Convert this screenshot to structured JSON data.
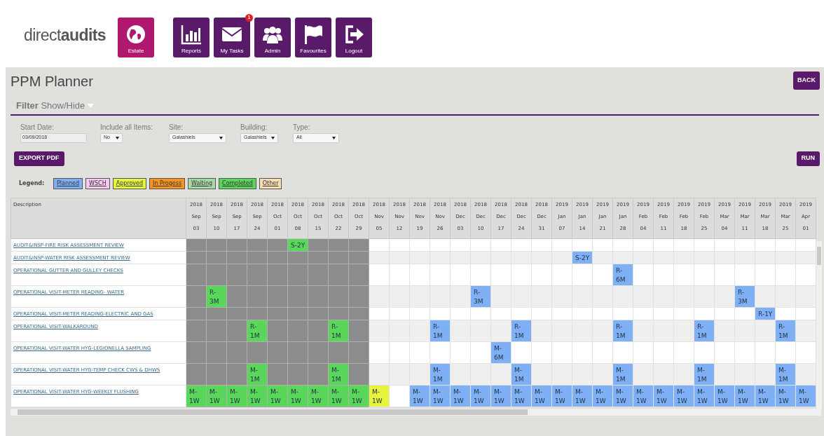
{
  "logo": "direct**audits**",
  "nav": [
    {
      "label": "Estate",
      "selected": true
    },
    {
      "label": "Reports",
      "selected": false
    },
    {
      "label": "My Tasks",
      "selected": false,
      "badge": "1"
    },
    {
      "label": "Admin",
      "selected": false
    },
    {
      "label": "Favourites",
      "selected": false
    },
    {
      "label": "Logout",
      "selected": false
    }
  ],
  "page_title": "PPM Planner",
  "back_button": "BACK",
  "filter_toggle": "**Filter** Show/Hide",
  "filters": [
    {
      "label": "Start Date:",
      "kind": "date",
      "value": "03/09/2018"
    },
    {
      "label": "Include all Items:",
      "kind": "select",
      "value": "No"
    },
    {
      "label": "Site:",
      "kind": "select",
      "value": "Galashiels"
    },
    {
      "label": "Building:",
      "kind": "select",
      "value": "Galashiels"
    },
    {
      "label": "Type:",
      "kind": "select",
      "value": "All"
    }
  ],
  "export_button": "EXPORT PDF",
  "run_button": "RUN",
  "legend_label": "Legend:",
  "legend": [
    {
      "label": "Planned",
      "color": "#7fb0f5"
    },
    {
      "label": "WSCH",
      "color": "#f7c8f0"
    },
    {
      "label": "Approved",
      "color": "#e6f53c"
    },
    {
      "label": "In Progess",
      "color": "#f7941d"
    },
    {
      "label": "Waiting",
      "color": "#a8d8a8"
    },
    {
      "label": "Completed",
      "color": "#5ad65a"
    },
    {
      "label": "Other",
      "color": "#f7dcb4"
    }
  ],
  "table": {
    "description_header": "Description",
    "columns": [
      {
        "year": "2018",
        "month": "Sep",
        "day": "03"
      },
      {
        "year": "2018",
        "month": "Sep",
        "day": "10"
      },
      {
        "year": "2018",
        "month": "Sep",
        "day": "17"
      },
      {
        "year": "2018",
        "month": "Sep",
        "day": "24"
      },
      {
        "year": "2018",
        "month": "Oct",
        "day": "01"
      },
      {
        "year": "2018",
        "month": "Oct",
        "day": "08"
      },
      {
        "year": "2018",
        "month": "Oct",
        "day": "15"
      },
      {
        "year": "2018",
        "month": "Oct",
        "day": "22"
      },
      {
        "year": "2018",
        "month": "Oct",
        "day": "29"
      },
      {
        "year": "2018",
        "month": "Nov",
        "day": "05"
      },
      {
        "year": "2018",
        "month": "Nov",
        "day": "12"
      },
      {
        "year": "2018",
        "month": "Nov",
        "day": "19"
      },
      {
        "year": "2018",
        "month": "Nov",
        "day": "26"
      },
      {
        "year": "2018",
        "month": "Dec",
        "day": "03"
      },
      {
        "year": "2018",
        "month": "Dec",
        "day": "10"
      },
      {
        "year": "2018",
        "month": "Dec",
        "day": "17"
      },
      {
        "year": "2018",
        "month": "Dec",
        "day": "24"
      },
      {
        "year": "2018",
        "month": "Dec",
        "day": "31"
      },
      {
        "year": "2019",
        "month": "Jan",
        "day": "07"
      },
      {
        "year": "2019",
        "month": "Jan",
        "day": "14"
      },
      {
        "year": "2019",
        "month": "Jan",
        "day": "21"
      },
      {
        "year": "2019",
        "month": "Jan",
        "day": "28"
      },
      {
        "year": "2019",
        "month": "Feb",
        "day": "04"
      },
      {
        "year": "2019",
        "month": "Feb",
        "day": "11"
      },
      {
        "year": "2019",
        "month": "Feb",
        "day": "18"
      },
      {
        "year": "2019",
        "month": "Feb",
        "day": "25"
      },
      {
        "year": "2019",
        "month": "Mar",
        "day": "04"
      },
      {
        "year": "2019",
        "month": "Mar",
        "day": "11"
      },
      {
        "year": "2019",
        "month": "Mar",
        "day": "18"
      },
      {
        "year": "2019",
        "month": "Mar",
        "day": "25"
      },
      {
        "year": "2019",
        "month": "Apr",
        "day": "01"
      }
    ],
    "rows": [
      {
        "description": "AUDIT&INSP-FIRE RISK ASSESSMENT REVIEW",
        "cells": [
          {
            "kind": "past"
          },
          {
            "kind": "past"
          },
          {
            "kind": "past"
          },
          {
            "kind": "past"
          },
          {
            "kind": "past"
          },
          {
            "kind": "completed",
            "text": "S-2Y"
          },
          {
            "kind": "past"
          },
          {
            "kind": "past"
          },
          {
            "kind": "past"
          },
          {
            "kind": "empty"
          },
          {
            "kind": "empty"
          },
          {
            "kind": "empty"
          },
          {
            "kind": "empty"
          },
          {
            "kind": "empty"
          },
          {
            "kind": "empty"
          },
          {
            "kind": "empty"
          },
          {
            "kind": "empty"
          },
          {
            "kind": "empty"
          },
          {
            "kind": "empty"
          },
          {
            "kind": "empty"
          },
          {
            "kind": "empty"
          },
          {
            "kind": "empty"
          },
          {
            "kind": "empty"
          },
          {
            "kind": "empty"
          },
          {
            "kind": "empty"
          },
          {
            "kind": "empty"
          },
          {
            "kind": "empty"
          },
          {
            "kind": "empty"
          },
          {
            "kind": "empty"
          },
          {
            "kind": "empty"
          },
          {
            "kind": "empty"
          }
        ]
      },
      {
        "description": "AUDIT&INSP-WATER RISK ASSESSMENT REVIEW",
        "cells": [
          {
            "kind": "past"
          },
          {
            "kind": "past"
          },
          {
            "kind": "past"
          },
          {
            "kind": "past"
          },
          {
            "kind": "past"
          },
          {
            "kind": "past"
          },
          {
            "kind": "past"
          },
          {
            "kind": "past"
          },
          {
            "kind": "past"
          },
          {
            "kind": "empty"
          },
          {
            "kind": "empty"
          },
          {
            "kind": "empty"
          },
          {
            "kind": "empty"
          },
          {
            "kind": "empty"
          },
          {
            "kind": "empty"
          },
          {
            "kind": "empty"
          },
          {
            "kind": "empty"
          },
          {
            "kind": "empty"
          },
          {
            "kind": "empty"
          },
          {
            "kind": "planned",
            "text": "S-2Y"
          },
          {
            "kind": "empty"
          },
          {
            "kind": "empty"
          },
          {
            "kind": "empty"
          },
          {
            "kind": "empty"
          },
          {
            "kind": "empty"
          },
          {
            "kind": "empty"
          },
          {
            "kind": "empty"
          },
          {
            "kind": "empty"
          },
          {
            "kind": "empty"
          },
          {
            "kind": "empty"
          },
          {
            "kind": "empty"
          }
        ]
      },
      {
        "description": "OPERATIONAL GUTTER AND GULLEY CHECKS",
        "cells": [
          {
            "kind": "past"
          },
          {
            "kind": "past"
          },
          {
            "kind": "past"
          },
          {
            "kind": "past"
          },
          {
            "kind": "past"
          },
          {
            "kind": "past"
          },
          {
            "kind": "past"
          },
          {
            "kind": "past"
          },
          {
            "kind": "past"
          },
          {
            "kind": "empty"
          },
          {
            "kind": "empty"
          },
          {
            "kind": "empty"
          },
          {
            "kind": "empty"
          },
          {
            "kind": "empty"
          },
          {
            "kind": "empty"
          },
          {
            "kind": "empty"
          },
          {
            "kind": "empty"
          },
          {
            "kind": "empty"
          },
          {
            "kind": "empty"
          },
          {
            "kind": "empty"
          },
          {
            "kind": "empty"
          },
          {
            "kind": "planned",
            "text": "R-6M"
          },
          {
            "kind": "empty"
          },
          {
            "kind": "empty"
          },
          {
            "kind": "empty"
          },
          {
            "kind": "empty"
          },
          {
            "kind": "empty"
          },
          {
            "kind": "empty"
          },
          {
            "kind": "empty"
          },
          {
            "kind": "empty"
          },
          {
            "kind": "empty"
          }
        ]
      },
      {
        "description": "OPERATIONAL VISIT-METER READING- WATER",
        "cells": [
          {
            "kind": "past"
          },
          {
            "kind": "completed",
            "text": "R-3M"
          },
          {
            "kind": "past"
          },
          {
            "kind": "past"
          },
          {
            "kind": "past"
          },
          {
            "kind": "past"
          },
          {
            "kind": "past"
          },
          {
            "kind": "past"
          },
          {
            "kind": "past"
          },
          {
            "kind": "empty"
          },
          {
            "kind": "empty"
          },
          {
            "kind": "empty"
          },
          {
            "kind": "empty"
          },
          {
            "kind": "empty"
          },
          {
            "kind": "planned",
            "text": "R-3M"
          },
          {
            "kind": "empty"
          },
          {
            "kind": "empty"
          },
          {
            "kind": "empty"
          },
          {
            "kind": "empty"
          },
          {
            "kind": "empty"
          },
          {
            "kind": "empty"
          },
          {
            "kind": "empty"
          },
          {
            "kind": "empty"
          },
          {
            "kind": "empty"
          },
          {
            "kind": "empty"
          },
          {
            "kind": "empty"
          },
          {
            "kind": "empty"
          },
          {
            "kind": "planned",
            "text": "R-3M"
          },
          {
            "kind": "empty"
          },
          {
            "kind": "empty"
          },
          {
            "kind": "empty"
          }
        ]
      },
      {
        "description": "OPERATIONAL VISIT-METER READING-ELECTRIC AND GAS",
        "cells": [
          {
            "kind": "past"
          },
          {
            "kind": "past"
          },
          {
            "kind": "past"
          },
          {
            "kind": "past"
          },
          {
            "kind": "past"
          },
          {
            "kind": "past"
          },
          {
            "kind": "past"
          },
          {
            "kind": "past"
          },
          {
            "kind": "past"
          },
          {
            "kind": "empty"
          },
          {
            "kind": "empty"
          },
          {
            "kind": "empty"
          },
          {
            "kind": "empty"
          },
          {
            "kind": "empty"
          },
          {
            "kind": "empty"
          },
          {
            "kind": "empty"
          },
          {
            "kind": "empty"
          },
          {
            "kind": "empty"
          },
          {
            "kind": "empty"
          },
          {
            "kind": "empty"
          },
          {
            "kind": "empty"
          },
          {
            "kind": "empty"
          },
          {
            "kind": "empty"
          },
          {
            "kind": "empty"
          },
          {
            "kind": "empty"
          },
          {
            "kind": "empty"
          },
          {
            "kind": "empty"
          },
          {
            "kind": "empty"
          },
          {
            "kind": "planned",
            "text": "R-1Y"
          },
          {
            "kind": "empty"
          },
          {
            "kind": "empty"
          }
        ]
      },
      {
        "description": "OPERATIONAL VISIT-WALKAROUND",
        "cells": [
          {
            "kind": "past"
          },
          {
            "kind": "past"
          },
          {
            "kind": "past"
          },
          {
            "kind": "completed",
            "text": "R-1M"
          },
          {
            "kind": "past"
          },
          {
            "kind": "past"
          },
          {
            "kind": "past"
          },
          {
            "kind": "completed",
            "text": "R-1M"
          },
          {
            "kind": "past"
          },
          {
            "kind": "empty"
          },
          {
            "kind": "empty"
          },
          {
            "kind": "empty"
          },
          {
            "kind": "planned",
            "text": "R-1M"
          },
          {
            "kind": "empty"
          },
          {
            "kind": "empty"
          },
          {
            "kind": "empty"
          },
          {
            "kind": "planned",
            "text": "R-1M"
          },
          {
            "kind": "empty"
          },
          {
            "kind": "empty"
          },
          {
            "kind": "empty"
          },
          {
            "kind": "empty"
          },
          {
            "kind": "planned",
            "text": "R-1M"
          },
          {
            "kind": "empty"
          },
          {
            "kind": "empty"
          },
          {
            "kind": "empty"
          },
          {
            "kind": "planned",
            "text": "R-1M"
          },
          {
            "kind": "empty"
          },
          {
            "kind": "empty"
          },
          {
            "kind": "empty"
          },
          {
            "kind": "planned",
            "text": "R-1M"
          },
          {
            "kind": "empty"
          }
        ]
      },
      {
        "description": "OPERATIONAL VISIT-WATER HYG-LEGIONELLA SAMPLING",
        "cells": [
          {
            "kind": "past"
          },
          {
            "kind": "past"
          },
          {
            "kind": "past"
          },
          {
            "kind": "past"
          },
          {
            "kind": "past"
          },
          {
            "kind": "past"
          },
          {
            "kind": "past"
          },
          {
            "kind": "past"
          },
          {
            "kind": "past"
          },
          {
            "kind": "empty"
          },
          {
            "kind": "empty"
          },
          {
            "kind": "empty"
          },
          {
            "kind": "empty"
          },
          {
            "kind": "empty"
          },
          {
            "kind": "empty"
          },
          {
            "kind": "planned",
            "text": "M-6M"
          },
          {
            "kind": "empty"
          },
          {
            "kind": "empty"
          },
          {
            "kind": "empty"
          },
          {
            "kind": "empty"
          },
          {
            "kind": "empty"
          },
          {
            "kind": "empty"
          },
          {
            "kind": "empty"
          },
          {
            "kind": "empty"
          },
          {
            "kind": "empty"
          },
          {
            "kind": "empty"
          },
          {
            "kind": "empty"
          },
          {
            "kind": "empty"
          },
          {
            "kind": "empty"
          },
          {
            "kind": "empty"
          },
          {
            "kind": "empty"
          }
        ]
      },
      {
        "description": "OPERATIONAL VISIT-WATER HYG-TEMP CHECK CWS & DHWS",
        "cells": [
          {
            "kind": "past"
          },
          {
            "kind": "past"
          },
          {
            "kind": "past"
          },
          {
            "kind": "completed",
            "text": "M-1M"
          },
          {
            "kind": "past"
          },
          {
            "kind": "past"
          },
          {
            "kind": "past"
          },
          {
            "kind": "completed",
            "text": "M-1M"
          },
          {
            "kind": "past"
          },
          {
            "kind": "empty"
          },
          {
            "kind": "empty"
          },
          {
            "kind": "empty"
          },
          {
            "kind": "planned",
            "text": "M-1M"
          },
          {
            "kind": "empty"
          },
          {
            "kind": "empty"
          },
          {
            "kind": "empty"
          },
          {
            "kind": "planned",
            "text": "M-1M"
          },
          {
            "kind": "empty"
          },
          {
            "kind": "empty"
          },
          {
            "kind": "empty"
          },
          {
            "kind": "empty"
          },
          {
            "kind": "planned",
            "text": "M-1M"
          },
          {
            "kind": "empty"
          },
          {
            "kind": "empty"
          },
          {
            "kind": "empty"
          },
          {
            "kind": "planned",
            "text": "M-1M"
          },
          {
            "kind": "empty"
          },
          {
            "kind": "empty"
          },
          {
            "kind": "empty"
          },
          {
            "kind": "planned",
            "text": "M-1M"
          },
          {
            "kind": "empty"
          }
        ]
      },
      {
        "description": "OPERATIONAL VISIT-WATER HYG-WEEKLY FLUSHING",
        "cells": [
          {
            "kind": "completed",
            "text": "M-1W"
          },
          {
            "kind": "completed",
            "text": "M-1W"
          },
          {
            "kind": "completed",
            "text": "M-1W"
          },
          {
            "kind": "completed",
            "text": "M-1W"
          },
          {
            "kind": "completed",
            "text": "M-1W"
          },
          {
            "kind": "completed",
            "text": "M-1W"
          },
          {
            "kind": "completed",
            "text": "M-1W"
          },
          {
            "kind": "completed",
            "text": "M-1W"
          },
          {
            "kind": "completed",
            "text": "M-1W"
          },
          {
            "kind": "approved",
            "text": "M-1W"
          },
          {
            "kind": "empty"
          },
          {
            "kind": "planned",
            "text": "M-1W"
          },
          {
            "kind": "planned",
            "text": "M-1W"
          },
          {
            "kind": "planned",
            "text": "M-1W"
          },
          {
            "kind": "planned",
            "text": "M-1W"
          },
          {
            "kind": "planned",
            "text": "M-1W"
          },
          {
            "kind": "planned",
            "text": "M-1W"
          },
          {
            "kind": "planned",
            "text": "M-1W"
          },
          {
            "kind": "planned",
            "text": "M-1W"
          },
          {
            "kind": "planned",
            "text": "M-1W"
          },
          {
            "kind": "planned",
            "text": "M-1W"
          },
          {
            "kind": "planned",
            "text": "M-1W"
          },
          {
            "kind": "planned",
            "text": "M-1W"
          },
          {
            "kind": "planned",
            "text": "M-1W"
          },
          {
            "kind": "planned",
            "text": "M-1W"
          },
          {
            "kind": "planned",
            "text": "M-1W"
          },
          {
            "kind": "planned",
            "text": "M-1W"
          },
          {
            "kind": "planned",
            "text": "M-1W"
          },
          {
            "kind": "planned",
            "text": "M-1W"
          },
          {
            "kind": "planned",
            "text": "M-1W"
          },
          {
            "kind": "planned",
            "text": "M-1W"
          }
        ]
      }
    ]
  }
}
